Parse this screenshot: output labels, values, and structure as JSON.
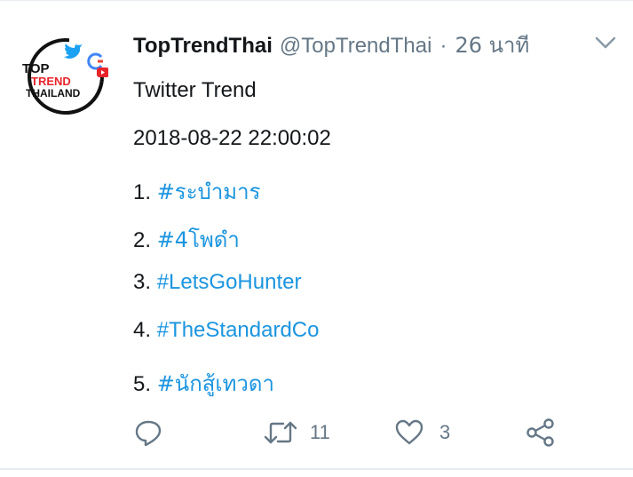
{
  "tweet": {
    "author": {
      "display_name": "TopTrendThai",
      "handle": "@TopTrendThai",
      "separator": "·",
      "time": "26 นาที",
      "avatar_text": [
        "TOP",
        "TREND",
        "THAILAND"
      ]
    },
    "title": "Twitter Trend",
    "timestamp": "2018-08-22 22:00:02",
    "trends": [
      {
        "rank": "1.",
        "tag": "#ระบำมาร"
      },
      {
        "rank": "2.",
        "tag": "#4โพดำ"
      },
      {
        "rank": "3.",
        "tag": "#LetsGoHunter"
      },
      {
        "rank": "4.",
        "tag": "#TheStandardCo"
      },
      {
        "rank": "5.",
        "tag": "#นักสู้เทวดา"
      }
    ],
    "actions": {
      "reply_icon": "reply-icon",
      "retweet_icon": "retweet-icon",
      "retweet_count": "11",
      "like_icon": "heart-icon",
      "like_count": "3",
      "share_icon": "share-icon"
    },
    "colors": {
      "link": "#1b95e0",
      "secondary": "#657786",
      "text": "#14171a",
      "avatar_red": "#e8232a",
      "twitter_blue": "#1da1f2"
    }
  }
}
